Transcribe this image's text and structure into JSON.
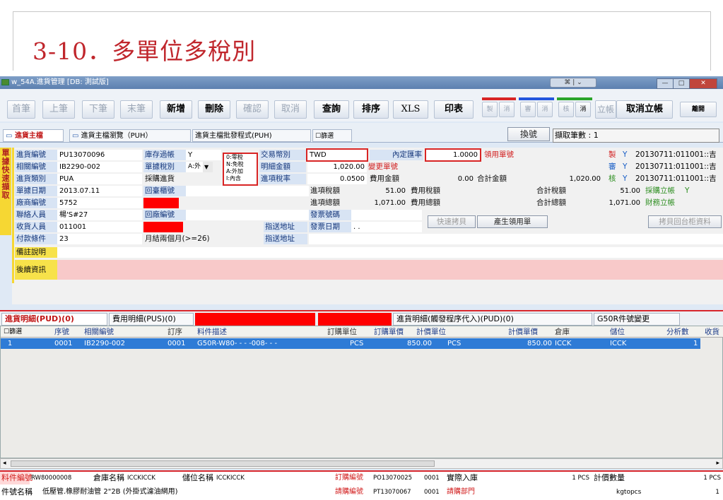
{
  "slide": {
    "title": "3-10．多單位多稅別"
  },
  "window": {
    "title": "w_54A.進貨管理 [DB: 測試版]",
    "center_ctrl": "⌘ | ⌄",
    "min": "—",
    "max": "□",
    "close": "✕"
  },
  "toolbar": {
    "first": "首筆",
    "prev": "上筆",
    "next": "下筆",
    "last": "末筆",
    "add": "新增",
    "delete": "刪除",
    "confirm": "確認",
    "cancel": "取消",
    "query": "查詢",
    "sort": "排序",
    "xls": "XLS",
    "print": "印表",
    "s1": "製",
    "s2": "消",
    "s3": "審",
    "s4": "消",
    "s5": "核",
    "s6": "消",
    "post": "立帳",
    "unpost": "取消立帳",
    "exit": "離開"
  },
  "tabs": {
    "main": "進貨主檔",
    "browse": "進貨主檔瀏覽（PUH）",
    "gen": "進貨主檔批發程式(PUH)",
    "filter": "篩選",
    "swap": "換號",
    "count": "擷取筆數 : 1"
  },
  "side_label": "單據快速擷取",
  "tax_legend": {
    "l1": "0:零稅",
    "l2": "N:免稅",
    "l3": "A:外加",
    "l4": "I:內含"
  },
  "form": {
    "doc_no_label": "進貨編號",
    "doc_no": "PU13070096",
    "stock_label": "庫存過帳",
    "stock": "Y",
    "tx_currency_label": "交易幣別",
    "tx_currency": "TWD",
    "rate_label": "內定匯率",
    "rate": "1.0000",
    "req_label": "領用單號",
    "mk_label": "製",
    "mk_flag": "Y",
    "mk_time": "20130711:011001::吉",
    "ref_label": "相關編號",
    "ref": "IB2290-002",
    "taxtype_label": "單據稅別",
    "taxtype": "A:外",
    "detail_amt_label": "明細金額",
    "detail_amt": "1,020.00",
    "chg_label": "變更單號",
    "rv_label": "審",
    "rv_flag": "Y",
    "rv_time": "20130711:011001::吉",
    "type_label": "進貨類別",
    "type": "PUA",
    "purchase_label": "採購進貨",
    "tax_rate_label": "進項稅率",
    "tax_rate": "0.0500",
    "fee_amt_label": "費用金額",
    "fee_amt": "0.00",
    "sum_amt_label": "合計金額",
    "sum_amt": "1,020.00",
    "ck_label": "核",
    "ck_flag": "Y",
    "ck_time": "20130711:011001::吉",
    "date_label": "單據日期",
    "date": "2013.07.11",
    "counter_label": "回臺櫃號",
    "tax_amt_label": "進項稅額",
    "tax_amt": "51.00",
    "fee_tax_label": "費用稅額",
    "sum_tax_label": "合計稅額",
    "sum_tax": "51.00",
    "ap_label": "採購立帳",
    "ap_flag": "Y",
    "vendor_label": "廠商編號",
    "vendor": "5752",
    "total_label": "進項總額",
    "total": "1,071.00",
    "fee_total_label": "費用總額",
    "sum_total_label": "合計總額",
    "sum_total": "1,071.00",
    "fin_label": "財務立帳",
    "contact_label": "聯絡人員",
    "contact": "楊'S#27",
    "factory_label": "回廠編號",
    "inv_no_label": "發票號碼",
    "receiver_label": "收貨人員",
    "receiver": "011001",
    "ship_addr_label": "指送地址",
    "inv_date_label": "發票日期",
    "inv_date": ". .",
    "pay_label": "付款條件",
    "pay": "23",
    "pay_desc": "月結兩個月(>=26)",
    "ship_addr2_label": "指送地址",
    "note_label": "備註說明",
    "remark_label": "後續資訊",
    "quick_copy": "快速拷貝",
    "gen_req": "產生領用單",
    "copy_back": "拷貝回台柜資料"
  },
  "detail_tabs": {
    "t1": "進貨明細(PUD)(0)",
    "t2": "費用明細(PUS)(0)",
    "t3": "進貨明細(觸發程序代入)(PUD)(0)",
    "t4": "G50R件號變更"
  },
  "grid": {
    "headers": {
      "filter": "篩選",
      "seq": "序號",
      "ref": "相關編號",
      "order_seq": "訂序",
      "desc": "料件描述",
      "unit": "訂購單位",
      "price": "訂購單價",
      "pu": "計價單位",
      "pp": "計價單價",
      "wh": "倉庫",
      "loc": "儲位",
      "qty": "分析數",
      "extra": "收貨"
    },
    "rows": [
      {
        "filter": "1",
        "seq": "0001",
        "ref": "IB2290-002",
        "order_seq": "0001",
        "desc": "G50R-W80- - - -008- - -",
        "unit": "PCS",
        "price": "850.00",
        "pu": "PCS",
        "pp": "850.00",
        "wh": "ICCK",
        "loc": "ICCK",
        "qty": "1"
      }
    ]
  },
  "bottom": {
    "part_no_label": "料件編號",
    "part_no": "RW80000008",
    "wh_name_label": "倉庫名稱",
    "wh_name": "ICCKICCK",
    "loc_name_label": "儲位名稱",
    "loc_name": "ICCKICCK",
    "po_label": "訂購編號",
    "po": "PO13070025",
    "po_seq": "0001",
    "actual_label": "實際入庫",
    "actual": "1 PCS",
    "price_qty_label": "計價數量",
    "price_qty": "1 PCS",
    "part_name_label": "件號名稱",
    "part_name": "低壓管.橡膠耐油管 2\"2B (外掛式濾油網用)",
    "req_no_label": "請購編號",
    "req_no": "PT13070067",
    "req_seq": "0001",
    "req_dept_label": "請購部門",
    "req_dept": "kgtopcs",
    "req_qty": "1"
  }
}
